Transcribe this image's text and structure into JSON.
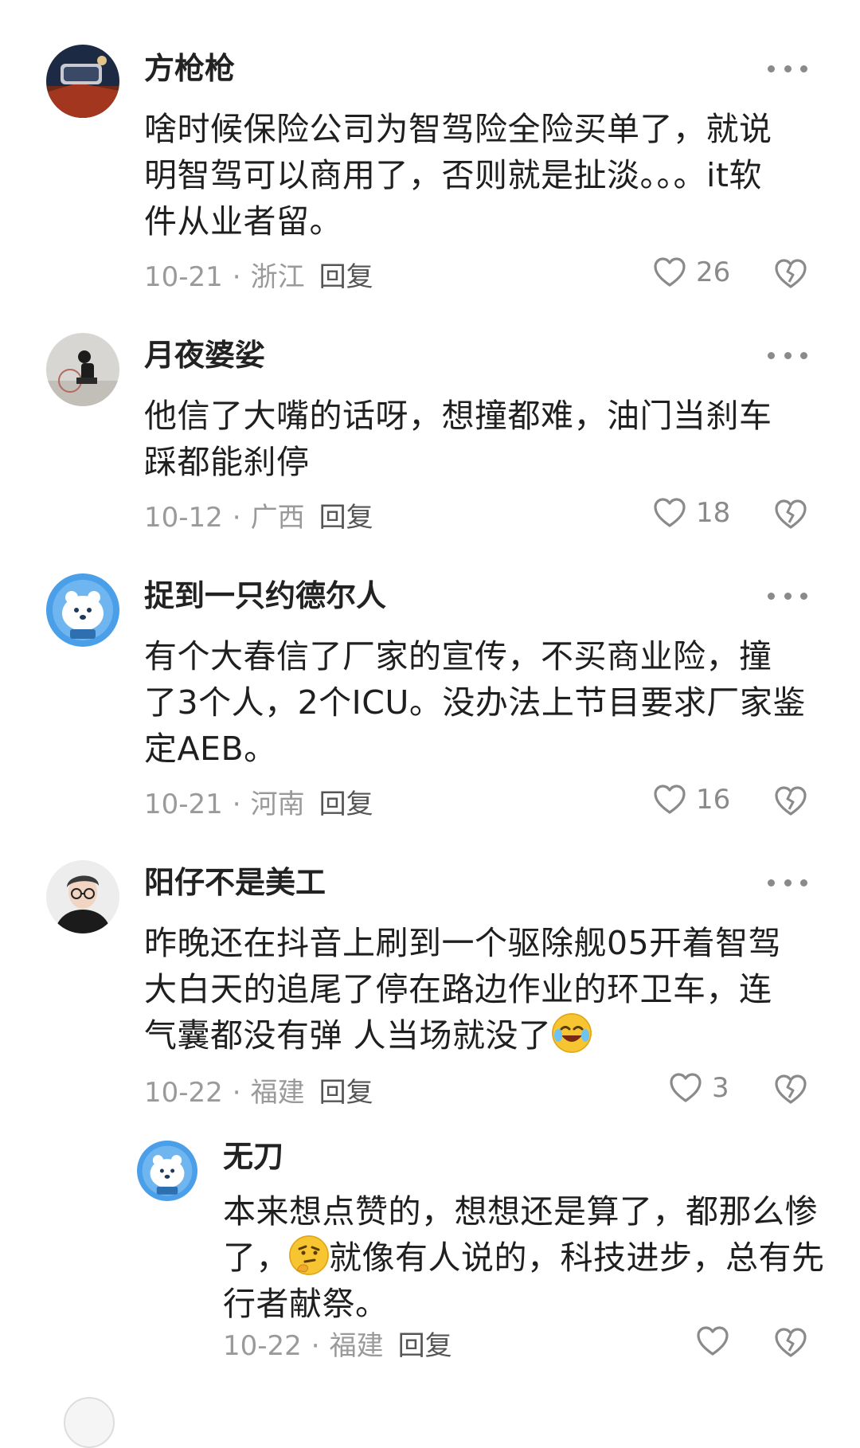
{
  "comments": [
    {
      "username": "方枪枪",
      "lines": [
        "啥时候保险公司为智驾险全险买单了，就说",
        "明智驾可以商用了，否则就是扯淡。。。it软",
        "件从业者留。"
      ],
      "date": "10-21",
      "location": "浙江",
      "reply": "回复",
      "likes": "26"
    },
    {
      "username": "月夜婆娑",
      "lines": [
        "他信了大嘴的话呀，想撞都难，油门当刹车",
        "踩都能刹停"
      ],
      "date": "10-12",
      "location": "广西",
      "reply": "回复",
      "likes": "18"
    },
    {
      "username": "捉到一只约德尔人",
      "lines": [
        "有个大春信了厂家的宣传，不买商业险，撞",
        "了3个人，2个ICU。没办法上节目要求厂家鉴",
        "定AEB。"
      ],
      "date": "10-21",
      "location": "河南",
      "reply": "回复",
      "likes": "16"
    },
    {
      "username": "阳仔不是美工",
      "lines": [
        "昨晚还在抖音上刷到一个驱除舰05开着智驾",
        "大白天的追尾了停在路边作业的环卫车，连",
        "气囊都没有弹 人当场就没了"
      ],
      "date": "10-22",
      "location": "福建",
      "reply": "回复",
      "likes": "3"
    }
  ],
  "sub_reply": {
    "username": "无刀",
    "line1": "本来想点赞的，想想还是算了，都那么惨",
    "line2_a": "了，",
    "line2_b": "就像有人说的，科技进步，总有先",
    "line3": "行者献祭。",
    "date": "10-22",
    "location": "福建",
    "reply": "回复"
  },
  "separator": "·",
  "icons": {
    "more": "more-dots-icon",
    "like": "heart-icon",
    "dislike": "broken-heart-icon",
    "emoji_laugh": "laugh-crying-emoji",
    "emoji_think": "thinking-emoji"
  }
}
